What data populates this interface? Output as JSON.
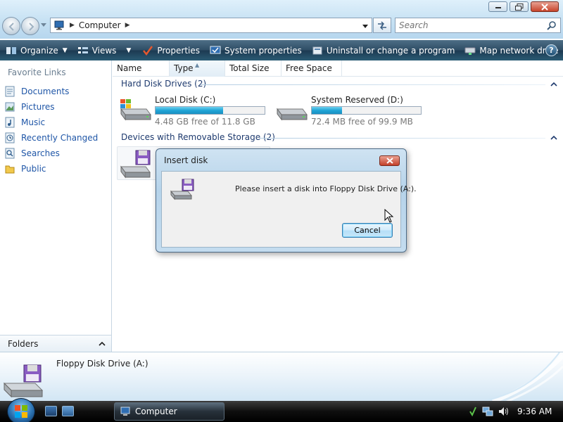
{
  "window": {
    "address": "Computer",
    "search_placeholder": "Search"
  },
  "toolbar": {
    "organize": "Organize",
    "views": "Views",
    "properties": "Properties",
    "system_properties": "System properties",
    "uninstall": "Uninstall or change a program",
    "map_drive": "Map network drive",
    "more": "»",
    "help": "?"
  },
  "sidebar": {
    "title": "Favorite Links",
    "items": [
      {
        "label": "Documents",
        "icon": "documents-icon"
      },
      {
        "label": "Pictures",
        "icon": "pictures-icon"
      },
      {
        "label": "Music",
        "icon": "music-icon"
      },
      {
        "label": "Recently Changed",
        "icon": "recently-changed-icon"
      },
      {
        "label": "Searches",
        "icon": "searches-icon"
      },
      {
        "label": "Public",
        "icon": "public-folder-icon"
      }
    ],
    "folders_label": "Folders"
  },
  "columns": [
    "Name",
    "Type",
    "Total Size",
    "Free Space"
  ],
  "groups": {
    "hard_disks": "Hard Disk Drives (2)",
    "removable": "Devices with Removable Storage (2)"
  },
  "drives": [
    {
      "name": "Local Disk (C:)",
      "free_text": "4.48 GB free of 11.8 GB",
      "used_fraction": 0.62
    },
    {
      "name": "System Reserved (D:)",
      "free_text": "72.4 MB free of 99.9 MB",
      "used_fraction": 0.28
    }
  ],
  "dialog": {
    "title": "Insert disk",
    "message": "Please insert a disk into Floppy Disk Drive (A:).",
    "cancel": "Cancel"
  },
  "details": {
    "name": "Floppy Disk Drive (A:)"
  },
  "taskbar": {
    "task": "Computer",
    "clock": "9:36 AM"
  },
  "colors": {
    "accent": "#20a5d6",
    "link": "#1f56a7",
    "command_bar": "#2f4e66"
  }
}
